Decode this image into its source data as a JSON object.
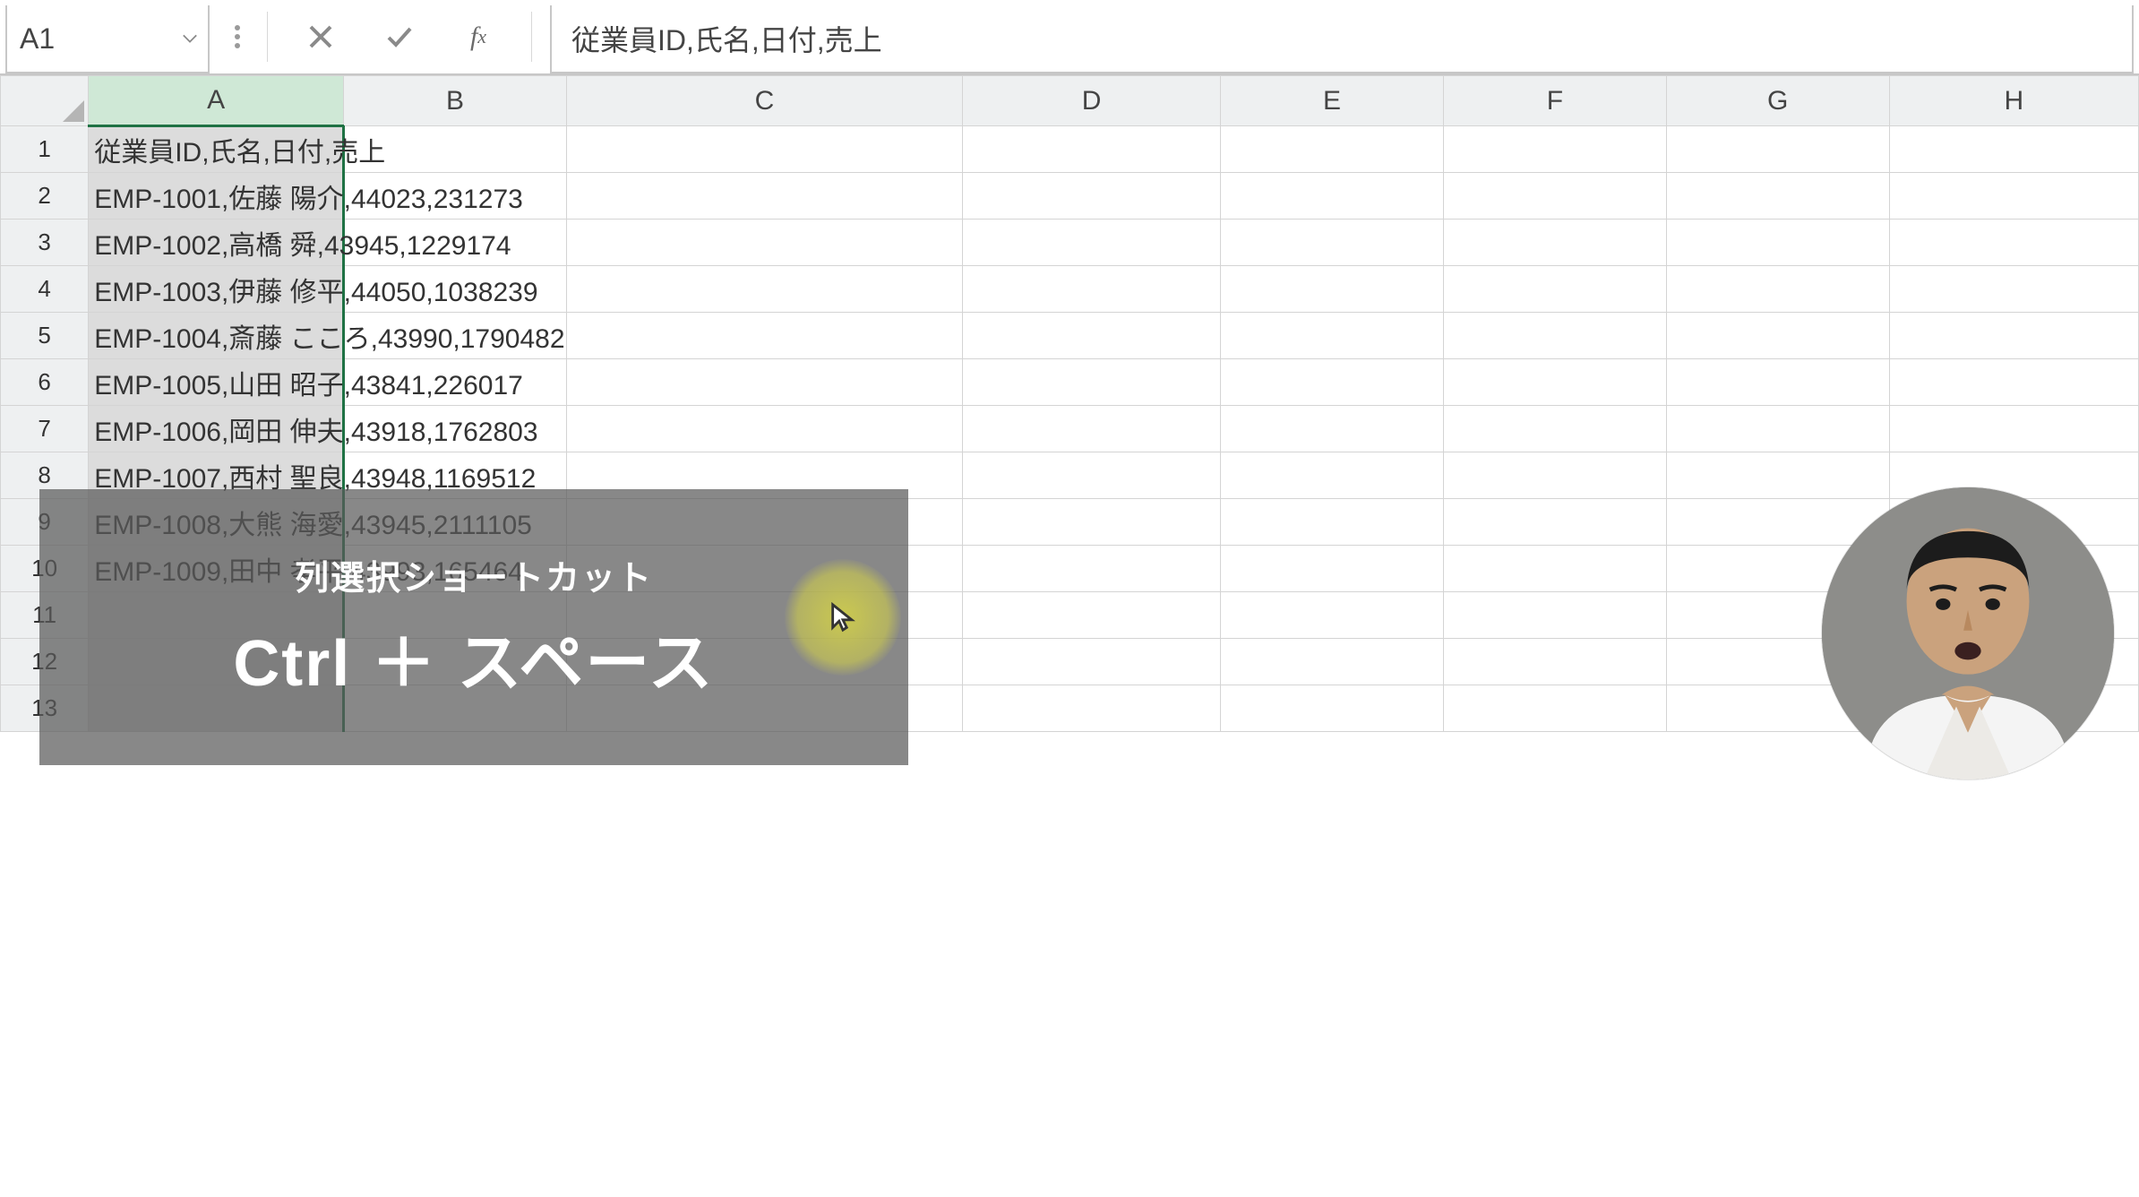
{
  "name_box": "A1",
  "formula_value": "従業員ID,氏名,日付,売上",
  "columns": [
    "A",
    "B",
    "C",
    "D",
    "E",
    "F",
    "G",
    "H"
  ],
  "selected_column": "A",
  "rows": [
    {
      "n": 1,
      "a": "従業員ID,氏名,日付,売上"
    },
    {
      "n": 2,
      "a": "EMP-1001,佐藤 陽介,44023,231273"
    },
    {
      "n": 3,
      "a": "EMP-1002,高橋 舜,43945,1229174"
    },
    {
      "n": 4,
      "a": "EMP-1003,伊藤 修平,44050,1038239"
    },
    {
      "n": 5,
      "a": "EMP-1004,斎藤 こころ,43990,1790482"
    },
    {
      "n": 6,
      "a": "EMP-1005,山田 昭子,43841,226017"
    },
    {
      "n": 7,
      "a": "EMP-1006,岡田 伸夫,43918,1762803"
    },
    {
      "n": 8,
      "a": "EMP-1007,西村 聖良,43948,1169512"
    },
    {
      "n": 9,
      "a": "EMP-1008,大熊 海愛,43945,2111105"
    },
    {
      "n": 10,
      "a": "EMP-1009,田中 孝平,43993,165464"
    },
    {
      "n": 11,
      "a": ""
    },
    {
      "n": 12,
      "a": ""
    },
    {
      "n": 13,
      "a": ""
    }
  ],
  "banner": {
    "line1": "列選択ショートカット",
    "line2": "Ctrl ＋ スペース"
  }
}
